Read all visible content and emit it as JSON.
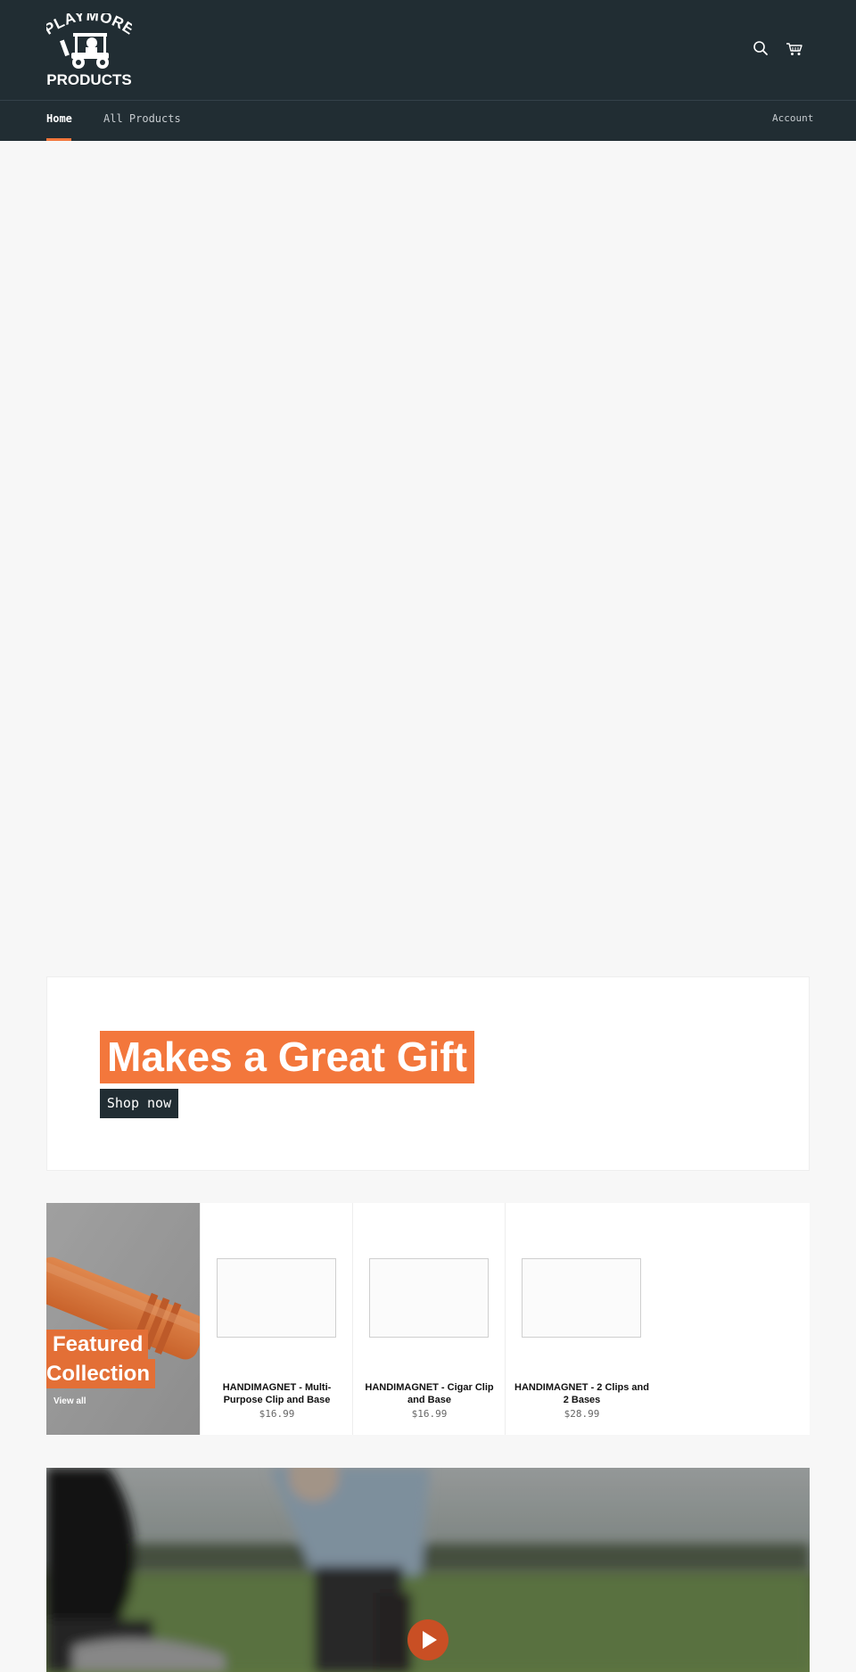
{
  "brand": {
    "logo_top": "PLAYMORE",
    "logo_bottom": "PRODUCTS"
  },
  "nav": {
    "home": "Home",
    "all_products": "All Products",
    "account": "Account"
  },
  "banner": {
    "title": "Makes a Great Gift",
    "button": "Shop now"
  },
  "collection": {
    "title_line1": "Featured",
    "title_line2": "Collection",
    "view_all": "View all",
    "products": [
      {
        "name": "HANDIMAGNET - Multi-Purpose Clip and Base",
        "price": "$16.99"
      },
      {
        "name": "HANDIMAGNET - Cigar Clip and Base",
        "price": "$16.99"
      },
      {
        "name": "HANDIMAGNET - 2 Clips and 2 Bases",
        "price": "$28.99"
      }
    ]
  },
  "colors": {
    "header_bg": "#212d33",
    "accent": "#f3773c",
    "page_bg": "#f7f7f7"
  },
  "icons": {
    "search": "search-icon",
    "cart": "cart-icon",
    "play": "play-icon"
  }
}
